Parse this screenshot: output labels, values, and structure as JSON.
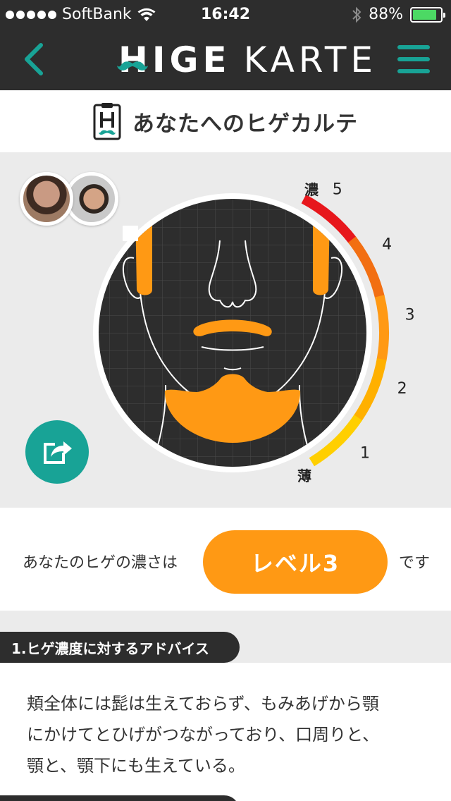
{
  "status_bar": {
    "carrier": "SoftBank",
    "time": "16:42",
    "battery_text": "88%",
    "battery_level": 0.88
  },
  "nav": {
    "logo_left": "HIGE",
    "logo_right": "KARTE",
    "accent_color": "#18a396"
  },
  "page": {
    "title": "あなたへのヒゲカルテ"
  },
  "chart": {
    "scale_top_label": "濃",
    "scale_bottom_label": "薄",
    "scale_numbers": [
      "5",
      "4",
      "3",
      "2",
      "1"
    ],
    "scale_colors": [
      "#e7171c",
      "#f26f12",
      "#ff9914",
      "#ffb000",
      "#ffcf00"
    ],
    "highlight_color": "#ff9914"
  },
  "result": {
    "prefix": "あなたのヒゲの濃さは",
    "level_label": "レベル3",
    "suffix": "です",
    "level": 3
  },
  "advice": {
    "section_title": "1.ヒゲ濃度に対するアドバイス",
    "lines": [
      "頬全体には髭は生えておらず、もみあげから顎",
      "にかけてとひげがつながっており、口周りと、",
      "顎と、顎下にも生えている。"
    ]
  }
}
